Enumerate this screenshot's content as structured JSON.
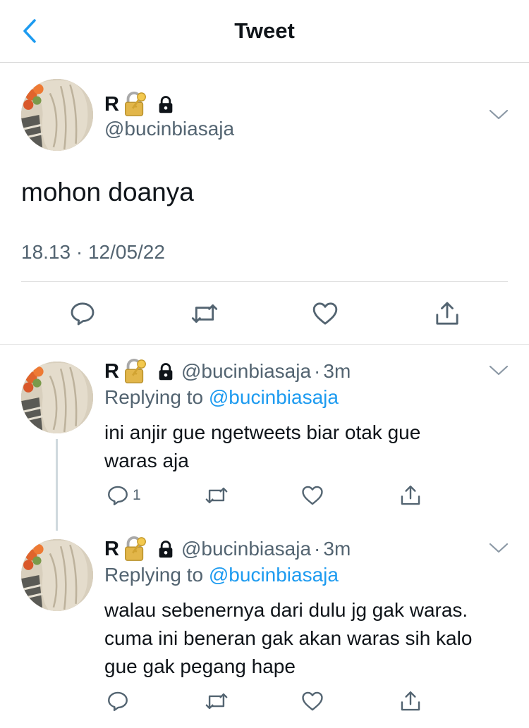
{
  "header": {
    "title": "Tweet",
    "back_icon": "chevron-left-icon",
    "accent": "#1d9bf0"
  },
  "main_tweet": {
    "name": "R",
    "handle": "@bucinbiasaja",
    "text": "mohon doanya",
    "timestamp": "18.13 · 12/05/22"
  },
  "replies": [
    {
      "name": "R",
      "handle": "@bucinbiasaja",
      "time": "3m",
      "replying_prefix": "Replying to",
      "replying_to": "@bucinbiasaja",
      "text_lines": [
        "ini anjir gue ngetweets biar otak gue",
        "waras aja"
      ],
      "reply_count": "1"
    },
    {
      "name": "R",
      "handle": "@bucinbiasaja",
      "time": "3m",
      "replying_prefix": "Replying to",
      "replying_to": "@bucinbiasaja",
      "text_lines": [
        "walau sebenernya dari dulu jg gak waras.",
        "cuma ini beneran gak akan waras sih kalo",
        "gue gak pegang hape"
      ]
    }
  ],
  "colors": {
    "text": "#0f1419",
    "muted": "#536471",
    "link": "#1d9bf0",
    "divider": "#e1e1e1"
  }
}
